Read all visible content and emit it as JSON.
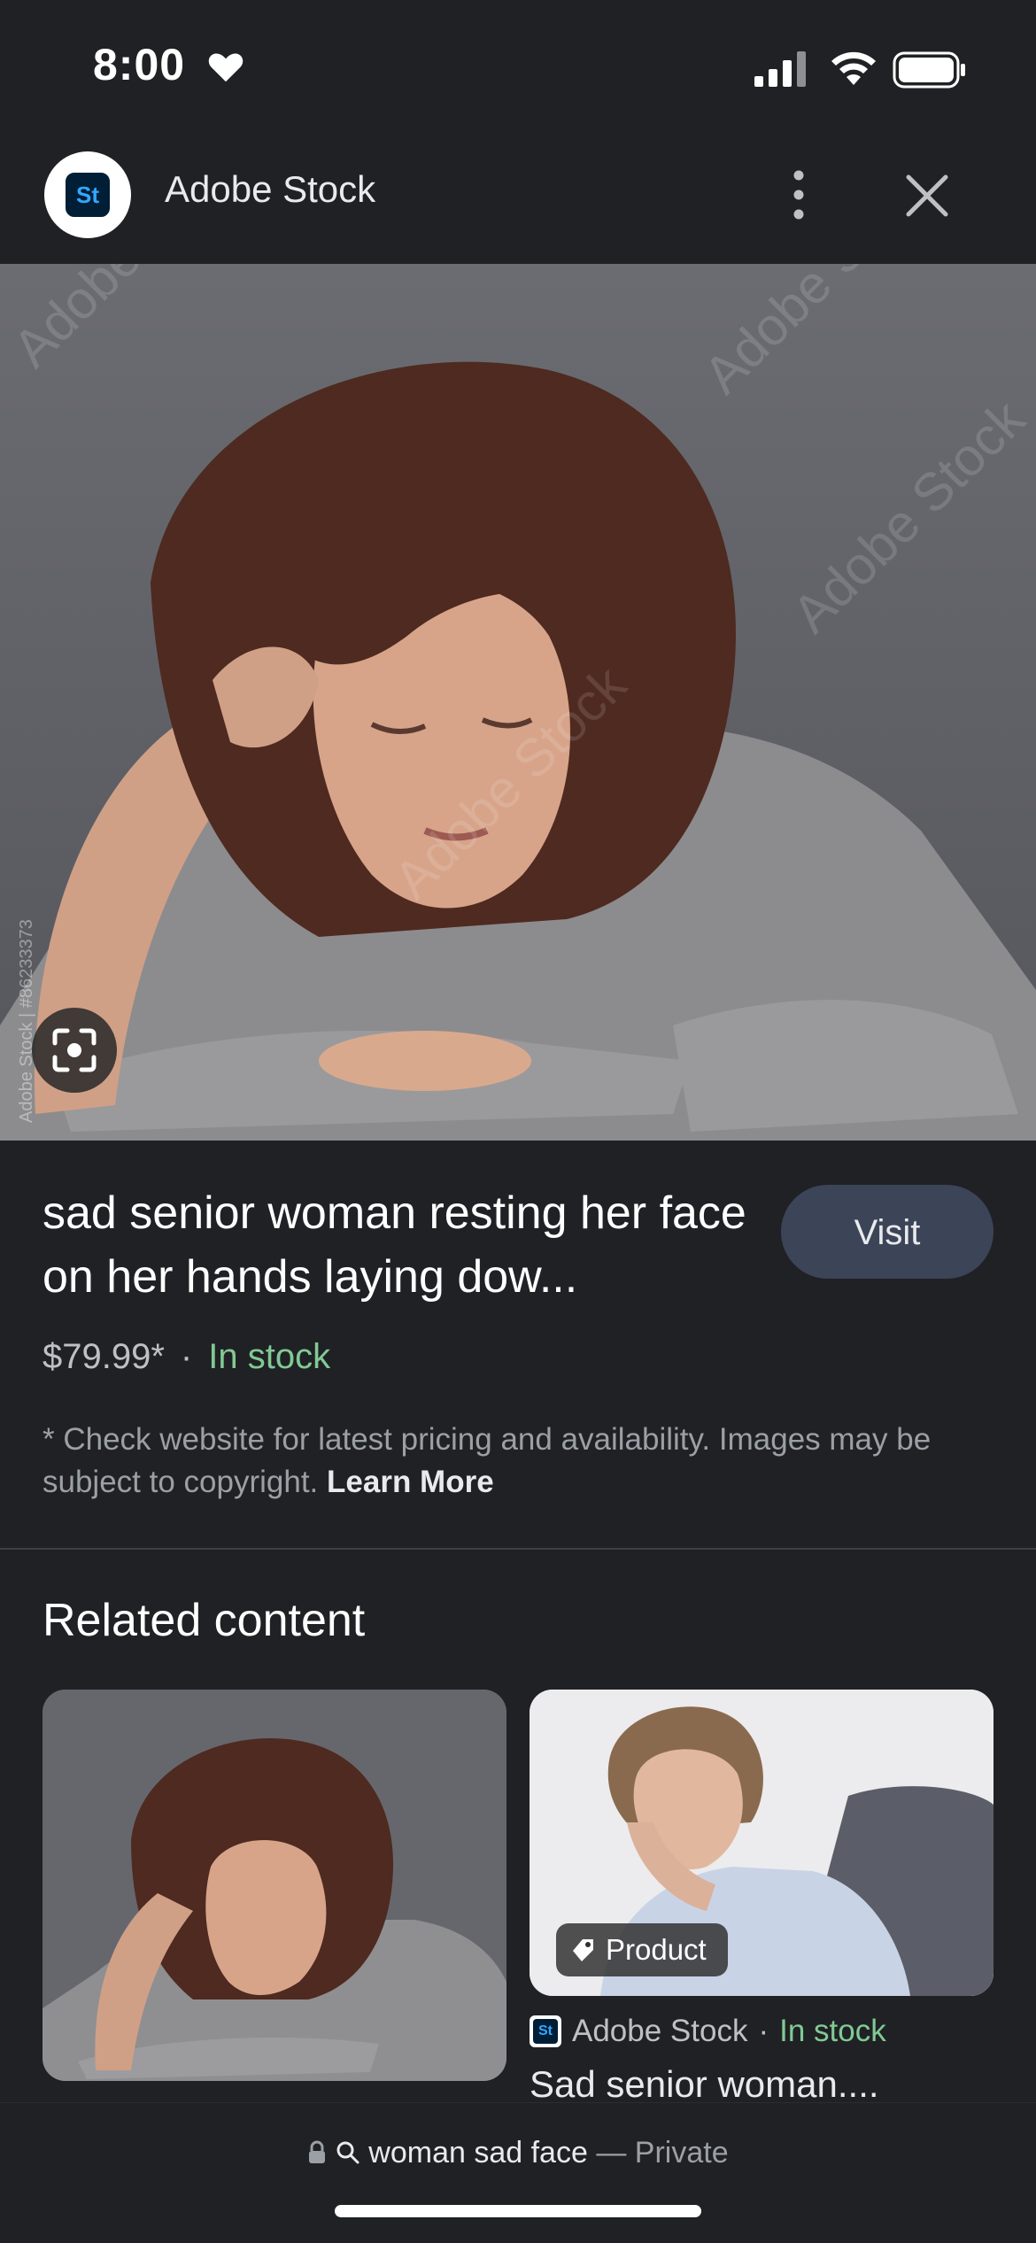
{
  "status_bar": {
    "time": "8:00"
  },
  "header": {
    "logo_text": "St",
    "title": "Adobe Stock"
  },
  "image": {
    "watermark_text": "Adobe Stock",
    "watermark_side": "Adobe Stock | #86233373"
  },
  "product": {
    "title": "sad senior woman resting her face on her hands laying dow...",
    "visit_label": "Visit",
    "price": "$79.99*",
    "separator": "·",
    "stock": "In stock",
    "disclaimer": "* Check website for latest pricing and availability. Images may be subject to copyright.",
    "learn_more": "Learn More"
  },
  "related": {
    "heading": "Related content",
    "cards": [
      {
        "kind": "image"
      },
      {
        "badge": "Product",
        "source": "Adobe Stock",
        "separator": "·",
        "stock": "In stock",
        "title": "Sad senior woman...."
      }
    ]
  },
  "bottom": {
    "query": "woman sad face",
    "dash": "—",
    "mode": "Private"
  },
  "colors": {
    "background": "#202124",
    "in_stock": "#81c995",
    "visit_button": "#3c4458"
  }
}
